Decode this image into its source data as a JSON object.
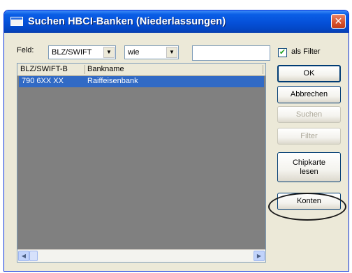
{
  "window": {
    "title": "Suchen HBCI-Banken (Niederlassungen)"
  },
  "filter": {
    "field_label": "Feld:",
    "field_value": "BLZ/SWIFT",
    "operator_value": "wie",
    "search_value": "",
    "filter_checkbox_label": "als Filter",
    "filter_checked": true
  },
  "list": {
    "columns": [
      "BLZ/SWIFT-B",
      "Bankname"
    ],
    "rows": [
      {
        "blz": "790 6XX XX",
        "name": "Raiffeisenbank"
      }
    ]
  },
  "buttons": {
    "ok": "OK",
    "cancel": "Abbrechen",
    "search": "Suchen",
    "filter": "Filter",
    "chipcard_line1": "Chipkarte",
    "chipcard_line2": "lesen",
    "accounts": "Konten"
  },
  "colors": {
    "titlebar": "#0550d8",
    "selection": "#316ac5",
    "list_background": "#808080",
    "dialog_background": "#ece9d8"
  },
  "icons": {
    "close": "close-icon",
    "app": "window-app-icon",
    "dropdown": "chevron-down-icon"
  }
}
